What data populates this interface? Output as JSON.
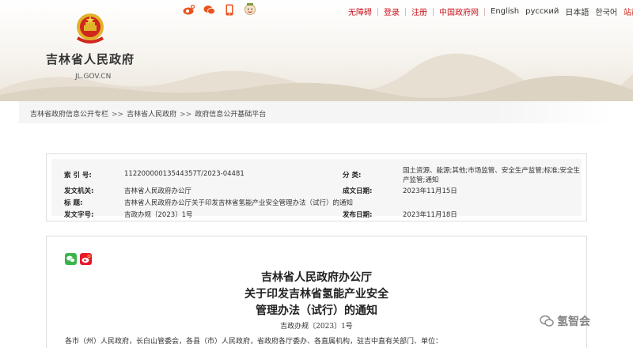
{
  "header": {
    "site_name": "吉林省人民政府",
    "site_domain": "JL.GOV.CN",
    "icons": [
      "weibo-icon",
      "wechat-icon",
      "mobile-icon",
      "mascot-icon"
    ],
    "links": {
      "accessibility": "无障碍",
      "login": "登录",
      "register": "注册",
      "china_gov": "中国政府网",
      "english": "English",
      "russian": "русский",
      "japanese": "日本語",
      "korean": "한국어",
      "sitemap": "站群导航"
    }
  },
  "breadcrumb": {
    "items": [
      "吉林省政府信息公开专栏",
      "吉林省人民政府",
      "政府信息公开基础平台"
    ],
    "separator": ">>"
  },
  "meta": {
    "index_label": "索 引 号:",
    "index_value": "11220000013544357T/2023-04481",
    "category_label": "分    类:",
    "category_value": "国土资源、能源;其他;市场监管、安全生产监管;标准;安全生产监管;通知",
    "org_label": "发文机关:",
    "org_value": "吉林省人民政府办公厅",
    "date_label": "成文日期:",
    "date_value": "2023年11月15日",
    "title_label": "标    题:",
    "title_value": "吉林省人民政府办公厅关于印发吉林省氢能产业安全管理办法（试行）的通知",
    "docno_label": "发文字号:",
    "docno_value": "吉政办规〔2023〕1号",
    "pub_label": "发布日期:",
    "pub_value": "2023年11月18日"
  },
  "document": {
    "title_line1": "吉林省人民政府办公厅",
    "title_line2": "关于印发吉林省氢能产业安全",
    "title_line3": "管理办法（试行）的通知",
    "number": "吉政办规〔2023〕1号",
    "recipients": "各市（州）人民政府，长白山管委会，各县（市）人民政府，省政府各厅委办、各直属机构，驻吉中直有关部门、单位："
  },
  "watermark": "氢智会",
  "colors": {
    "brand_red": "#c8141e",
    "accent_orange": "#d22b1e"
  }
}
